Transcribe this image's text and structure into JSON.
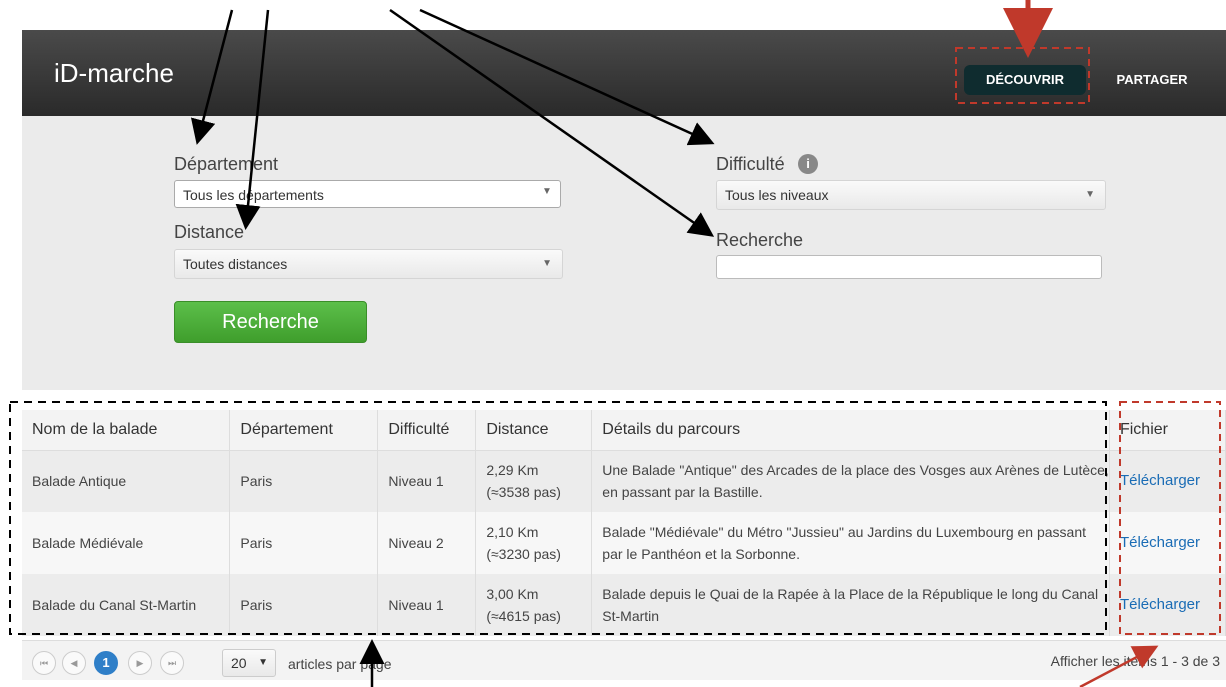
{
  "header": {
    "brand": "iD-marche",
    "nav": {
      "decouvrir": "DÉCOUVRIR",
      "partager": "PARTAGER"
    }
  },
  "filters": {
    "departement": {
      "label": "Département",
      "value": "Tous les départements"
    },
    "distance": {
      "label": "Distance",
      "value": "Toutes distances"
    },
    "difficulte": {
      "label": "Difficulté",
      "value": "Tous les niveaux"
    },
    "recherche": {
      "label": "Recherche",
      "value": ""
    },
    "search_button": "Recherche"
  },
  "table": {
    "columns": [
      "Nom de la balade",
      "Département",
      "Difficulté",
      "Distance",
      "Détails du parcours",
      "Fichier"
    ],
    "rows": [
      {
        "name": "Balade Antique",
        "departement": "Paris",
        "difficulte": "Niveau 1",
        "distance_km": "2,29 Km",
        "distance_pas": "(≈3538 pas)",
        "details": "Une Balade \"Antique\" des Arcades de la place des Vosges aux Arènes de Lutèce, en passant par la Bastille.",
        "fichier": "Télécharger"
      },
      {
        "name": "Balade Médiévale",
        "departement": "Paris",
        "difficulte": "Niveau 2",
        "distance_km": "2,10 Km",
        "distance_pas": "(≈3230 pas)",
        "details": "Balade \"Médiévale\" du Métro \"Jussieu\" au Jardins du Luxembourg en passant par le Panthéon et la Sorbonne.",
        "fichier": "Télécharger"
      },
      {
        "name": "Balade du Canal St-Martin",
        "departement": "Paris",
        "difficulte": "Niveau 1",
        "distance_km": "3,00 Km",
        "distance_pas": "(≈4615 pas)",
        "details": "Balade depuis le Quai de la Rapée à la Place de la République le long du Canal St-Martin",
        "fichier": "Télécharger"
      }
    ]
  },
  "pager": {
    "current_page": "1",
    "page_size": "20",
    "page_size_label": "articles par page",
    "info": "Afficher les items 1 - 3 de 3"
  },
  "icons": {
    "info": "info-icon",
    "dropdown": "chevron-down-icon",
    "first": "first-page-icon",
    "prev": "prev-page-icon",
    "next": "next-page-icon",
    "last": "last-page-icon"
  }
}
